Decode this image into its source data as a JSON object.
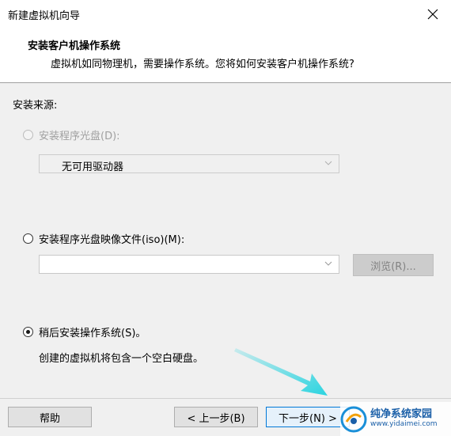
{
  "window": {
    "title": "新建虚拟机向导",
    "close_icon": "close-icon"
  },
  "header": {
    "title": "安装客户机操作系统",
    "subtitle": "虚拟机如同物理机，需要操作系统。您将如何安装客户机操作系统?"
  },
  "install_source": {
    "label": "安装来源:",
    "option_disc": {
      "label": "安装程序光盘(D):",
      "selected": false,
      "enabled": false,
      "dropdown_value": "无可用驱动器"
    },
    "option_iso": {
      "label": "安装程序光盘映像文件(iso)(M):",
      "selected": false,
      "enabled": true,
      "dropdown_value": "",
      "browse_label": "浏览(R)..."
    },
    "option_later": {
      "label": "稍后安装操作系统(S)。",
      "selected": true,
      "enabled": true,
      "description": "创建的虚拟机将包含一个空白硬盘。"
    }
  },
  "footer": {
    "help_label": "帮助",
    "back_label": "< 上一步(B)",
    "next_label": "下一步(N) >"
  },
  "watermark": {
    "title": "纯净系统家园",
    "url": "www.yidaimei.com"
  },
  "colors": {
    "accent": "#0078d7",
    "arrow": "#2bd4e0",
    "disabled_text": "#a0a0a0"
  }
}
